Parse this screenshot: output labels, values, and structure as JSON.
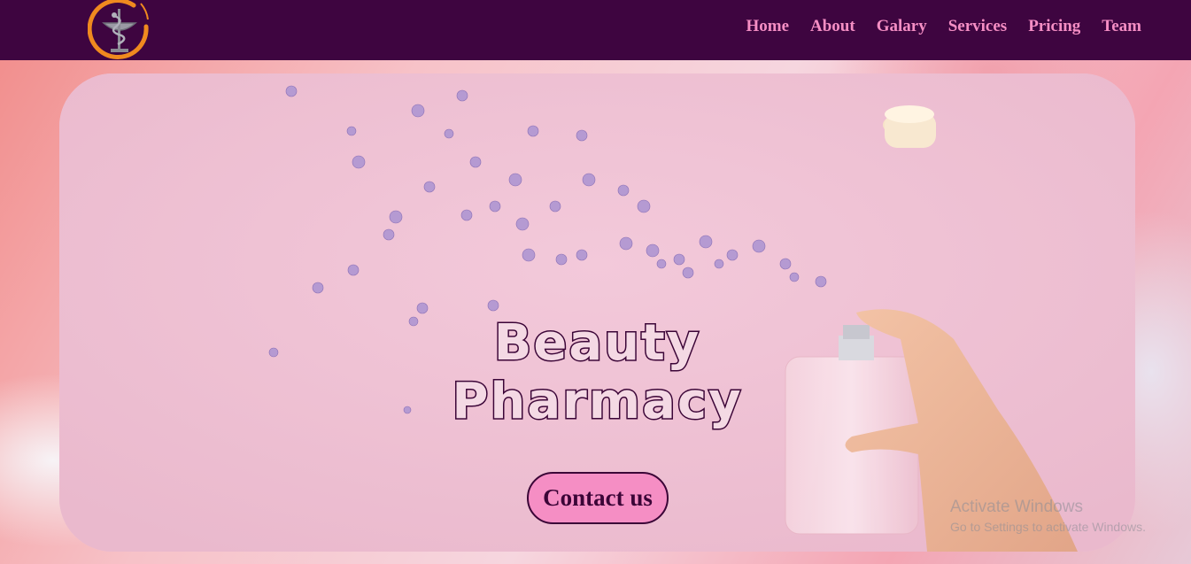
{
  "nav": {
    "logo_icon": "caduceus-bowl-logo",
    "links": [
      {
        "label": "Home"
      },
      {
        "label": "About"
      },
      {
        "label": "Galary"
      },
      {
        "label": "Services"
      },
      {
        "label": "Pricing"
      },
      {
        "label": "Team"
      }
    ]
  },
  "hero": {
    "title_line1": "Beauty",
    "title_line2": "Pharmacy",
    "cta_label": "Contact us",
    "image": "perfume-bottle-with-lilac-petals"
  },
  "watermark": {
    "line1": "Activate Windows",
    "line2": "Go to Settings to activate Windows."
  },
  "colors": {
    "navbar": "#3e0540",
    "nav_link": "#f58ec4",
    "cta_bg": "#f58ec4",
    "title_outline": "#3b0537"
  }
}
